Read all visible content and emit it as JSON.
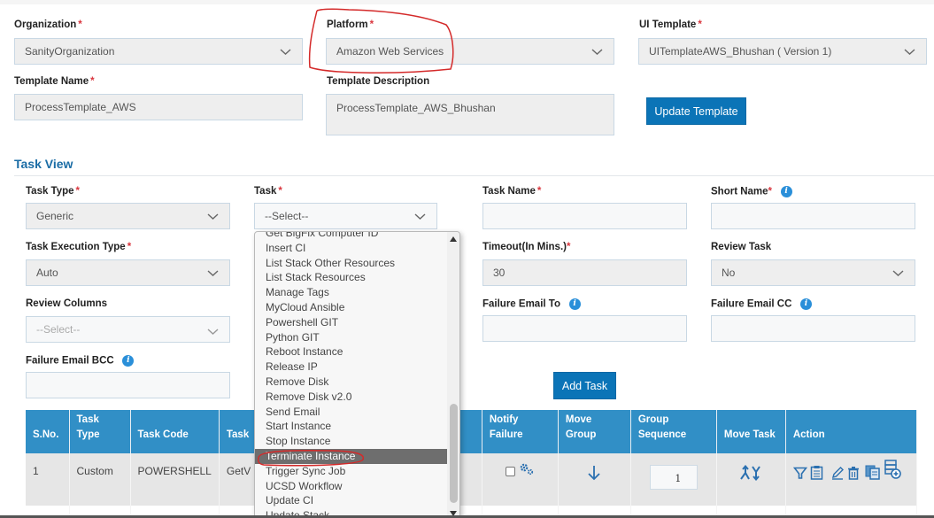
{
  "template_form": {
    "organization": {
      "label": "Organization",
      "required": "*",
      "value": "SanityOrganization"
    },
    "platform": {
      "label": "Platform",
      "required": "*",
      "value": "Amazon Web Services"
    },
    "ui_template": {
      "label": "UI Template",
      "required": "*",
      "value": "UITemplateAWS_Bhushan ( Version 1)"
    },
    "template_name": {
      "label": "Template Name",
      "required": "*",
      "value": "ProcessTemplate_AWS"
    },
    "template_description": {
      "label": "Template Description",
      "value": "ProcessTemplate_AWS_Bhushan"
    },
    "update_button": "Update Template"
  },
  "task_view": {
    "title": "Task View",
    "task_type": {
      "label": "Task Type",
      "required": "*",
      "value": "Generic"
    },
    "task": {
      "label": "Task",
      "required": "*",
      "value": "--Select--"
    },
    "task_name": {
      "label": "Task Name",
      "required": "*",
      "value": ""
    },
    "short_name": {
      "label": "Short Name",
      "required": "*",
      "value": ""
    },
    "task_execution_type": {
      "label": "Task Execution Type",
      "required": "*",
      "value": "Auto"
    },
    "timeout": {
      "label": "Timeout(In Mins.)",
      "required": "*",
      "value": "30"
    },
    "review_task": {
      "label": "Review Task",
      "value": "No"
    },
    "review_columns": {
      "label": "Review Columns",
      "value": "--Select--"
    },
    "failure_email_to": {
      "label": "Failure Email To",
      "value": ""
    },
    "failure_email_cc": {
      "label": "Failure Email CC",
      "value": ""
    },
    "failure_email_bcc": {
      "label": "Failure Email BCC",
      "value": ""
    },
    "add_task_button": "Add Task"
  },
  "task_dropdown": {
    "options": [
      "Get BigFix Computer ID",
      "Insert CI",
      "List Stack Other Resources",
      "List Stack Resources",
      "Manage Tags",
      "MyCloud Ansible",
      "Powershell GIT",
      "Python GIT",
      "Reboot Instance",
      "Release IP",
      "Remove Disk",
      "Remove Disk v2.0",
      "Send Email",
      "Start Instance",
      "Stop Instance",
      "Terminate Instance",
      "Trigger Sync Job",
      "UCSD Workflow",
      "Update CI",
      "Update Stack"
    ],
    "highlighted": "Terminate Instance"
  },
  "table": {
    "headers": [
      "S.No.",
      "Task Type",
      "Task Code",
      "Task",
      "Notify Failure",
      "Move Group",
      "Group Sequence",
      "Move Task",
      "Action"
    ],
    "rows": [
      {
        "sno": "1",
        "task_type": "Custom",
        "task_code": "POWERSHELL",
        "task": "GetV",
        "group_sequence": "1"
      }
    ]
  },
  "colors": {
    "accent": "#0b74b7",
    "table_header": "#318fc6",
    "highlight": "#6e6e6e",
    "annotation": "#d9363e"
  }
}
